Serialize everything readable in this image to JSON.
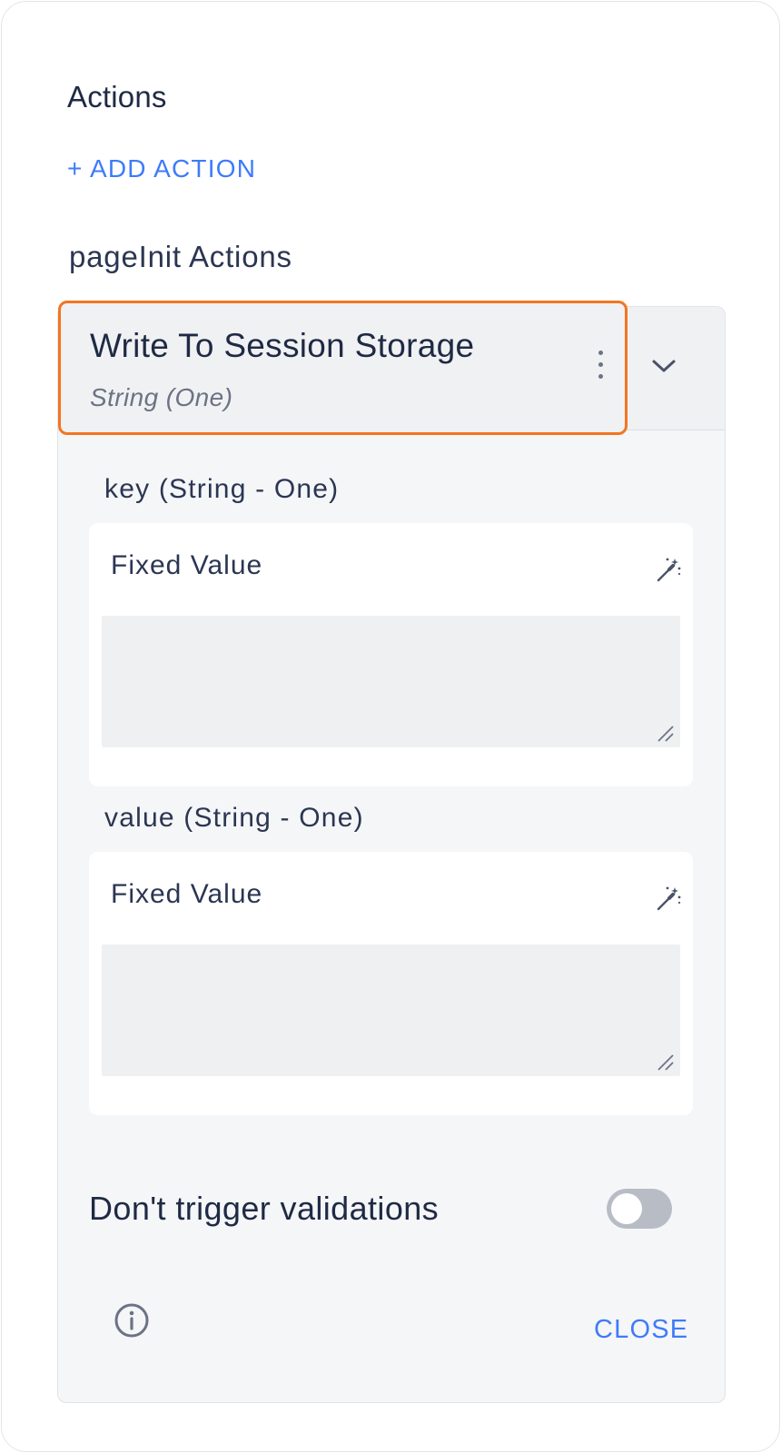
{
  "actions_panel": {
    "title": "Actions",
    "add_action_label": "+ ADD ACTION",
    "group_title": "pageInit Actions"
  },
  "action_item": {
    "name": "Write To Session Storage",
    "type": "String (One)"
  },
  "fields": [
    {
      "label": "key (String - One)",
      "mode": "Fixed Value",
      "value": ""
    },
    {
      "label": "value (String - One)",
      "mode": "Fixed Value",
      "value": ""
    }
  ],
  "toggle": {
    "label": "Don't trigger validations",
    "checked": false
  },
  "footer": {
    "close_label": "CLOSE"
  },
  "colors": {
    "accent": "#3e7bfa",
    "highlight_border": "#f37521",
    "text_primary": "#1f2a44"
  },
  "icons": {
    "more": "more-vertical-icon",
    "expand": "chevron-down-icon",
    "dynamic_value": "magic-wand-icon",
    "info": "info-icon"
  }
}
